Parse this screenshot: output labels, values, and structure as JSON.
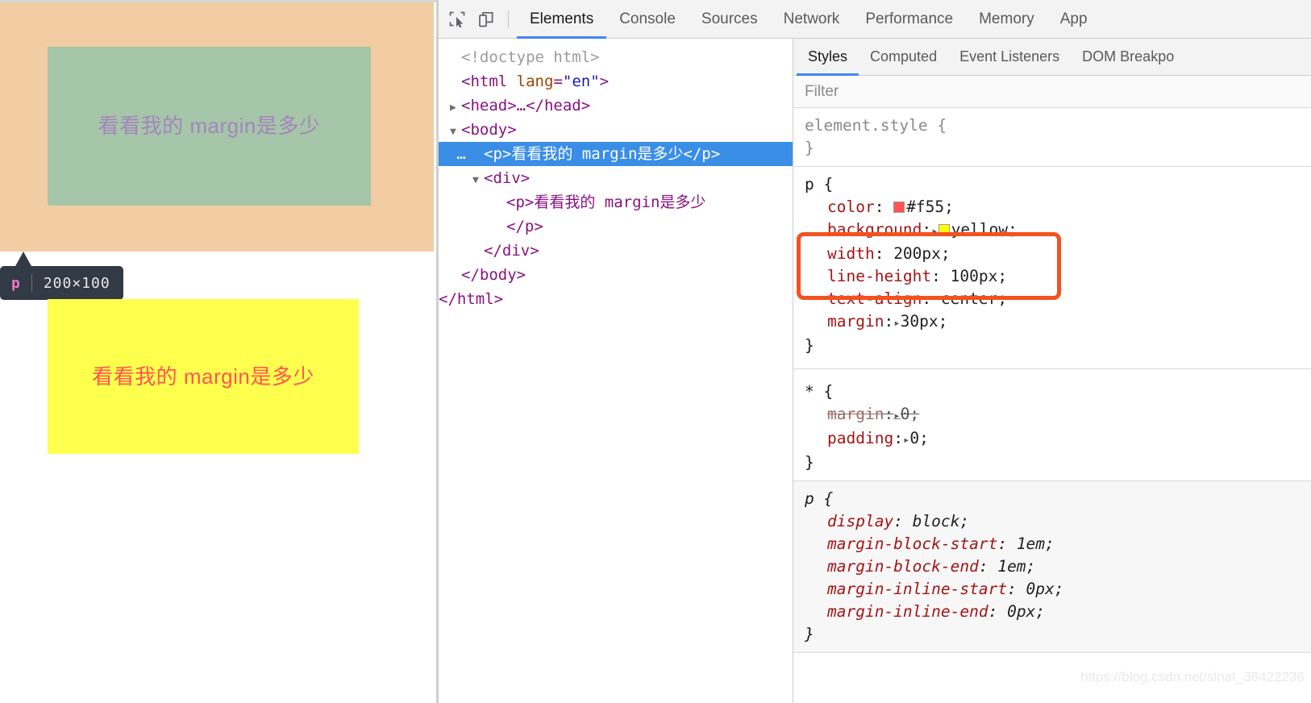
{
  "page": {
    "highlighted_text": "看看我的 margin是多少",
    "yellow_text": "看看我的 margin是多少",
    "tooltip": {
      "tag": "p",
      "dimensions": "200×100"
    },
    "colors": {
      "margin_overlay": "#f2cda3",
      "content_box": "#a5c6a9",
      "highlight_text": "#a585bd",
      "yellow_box": "#ffff4d",
      "yellow_text": "#f55",
      "tooltip_bg": "#323a45",
      "tooltip_tag": "#f178c0"
    }
  },
  "devtools": {
    "toolbar": {
      "inspect_icon": "inspect-element-icon",
      "device_icon": "device-toolbar-icon"
    },
    "tabs": [
      {
        "label": "Elements",
        "active": true
      },
      {
        "label": "Console",
        "active": false
      },
      {
        "label": "Sources",
        "active": false
      },
      {
        "label": "Network",
        "active": false
      },
      {
        "label": "Performance",
        "active": false
      },
      {
        "label": "Memory",
        "active": false
      },
      {
        "label": "App",
        "active": false
      }
    ],
    "dom": {
      "doctype": "<!doctype html>",
      "html_open_lt": "<",
      "html_tag": "html",
      "html_attr_name": "lang",
      "html_attr_eq": "=",
      "html_attr_val": "\"en\"",
      "html_open_gt": ">",
      "head_line": "<head>…</head>",
      "body_open": "<body>",
      "selected_ellipsis": "…",
      "selected_line": "<p>看看我的 margin是多少</p>",
      "div_open": "<div>",
      "inner_p_open": "<p>看看我的 margin是多少",
      "inner_p_close": "</p>",
      "div_close": "</div>",
      "body_close": "</body>",
      "html_close": "</html>"
    },
    "styles": {
      "tabs": [
        {
          "label": "Styles",
          "active": true
        },
        {
          "label": "Computed",
          "active": false
        },
        {
          "label": "Event Listeners",
          "active": false
        },
        {
          "label": "DOM Breakpo",
          "active": false
        }
      ],
      "filter_placeholder": "Filter",
      "filter_value": "",
      "rules": [
        {
          "selector": "element.style",
          "origin": "inline",
          "declarations": []
        },
        {
          "selector": "p",
          "origin": "author",
          "annotated": true,
          "declarations": [
            {
              "property": "color",
              "value": "#f55",
              "swatch": "#f55",
              "has_expander": false,
              "struck": false
            },
            {
              "property": "background",
              "value": "yellow",
              "swatch": "#ffff00",
              "has_expander": true,
              "struck": false
            },
            {
              "property": "width",
              "value": "200px",
              "swatch": null,
              "has_expander": false,
              "struck": false
            },
            {
              "property": "line-height",
              "value": "100px",
              "swatch": null,
              "has_expander": false,
              "struck": false
            },
            {
              "property": "text-align",
              "value": "center",
              "swatch": null,
              "has_expander": false,
              "struck": false
            },
            {
              "property": "margin",
              "value": "30px",
              "swatch": null,
              "has_expander": true,
              "struck": false
            }
          ]
        },
        {
          "selector": "*",
          "origin": "author",
          "declarations": [
            {
              "property": "margin",
              "value": "0",
              "swatch": null,
              "has_expander": true,
              "struck": true
            },
            {
              "property": "padding",
              "value": "0",
              "swatch": null,
              "has_expander": true,
              "struck": false
            }
          ]
        },
        {
          "selector": "p",
          "origin": "user-agent",
          "declarations": [
            {
              "property": "display",
              "value": "block",
              "swatch": null,
              "has_expander": false,
              "struck": false
            },
            {
              "property": "margin-block-start",
              "value": "1em",
              "swatch": null,
              "has_expander": false,
              "struck": false
            },
            {
              "property": "margin-block-end",
              "value": "1em",
              "swatch": null,
              "has_expander": false,
              "struck": false
            },
            {
              "property": "margin-inline-start",
              "value": "0px",
              "swatch": null,
              "has_expander": false,
              "struck": false
            },
            {
              "property": "margin-inline-end",
              "value": "0px",
              "swatch": null,
              "has_expander": false,
              "struck": false
            }
          ]
        }
      ],
      "annotation_color": "#f4511e"
    }
  },
  "watermark": "https://blog.csdn.net/sinat_36422236"
}
